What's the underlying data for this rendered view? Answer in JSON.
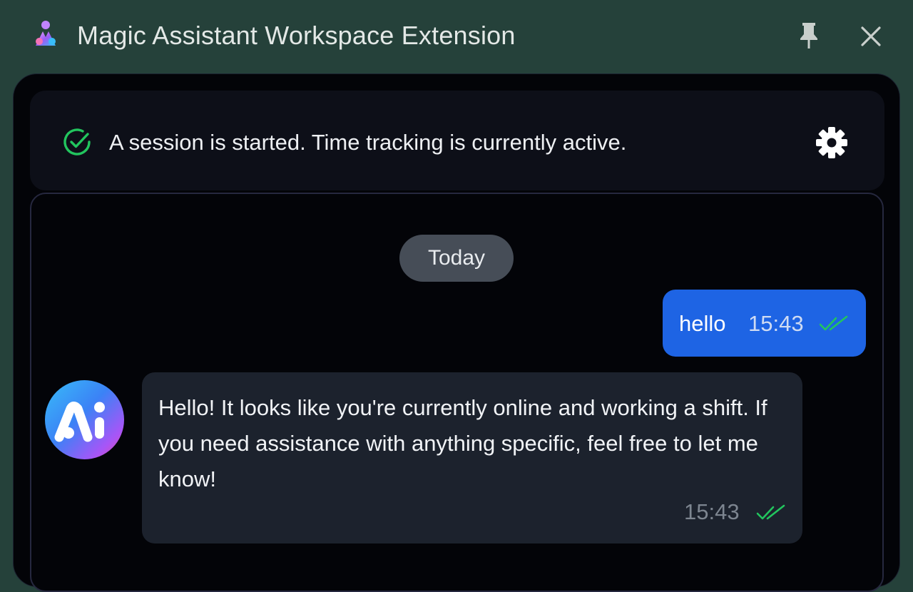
{
  "window": {
    "title": "Magic Assistant Workspace Extension",
    "logo_icon": "magic-assistant-logo-icon",
    "pin_icon": "pin-icon",
    "close_icon": "close-icon"
  },
  "session": {
    "status_text": "A session is started. Time tracking is currently active.",
    "status_icon": "check-circle-icon",
    "status_color": "#22c55e",
    "settings_icon": "gear-icon"
  },
  "chat": {
    "date_divider": "Today",
    "messages": [
      {
        "sender": "user",
        "text": "hello",
        "time": "15:43",
        "status_icon": "double-check-icon",
        "bubble_color": "#1e64e4"
      },
      {
        "sender": "assistant",
        "avatar_text": "Ai",
        "text": "Hello! It looks like you're currently online and working a shift. If you need assistance with anything specific, feel free to let me know!",
        "time": "15:43",
        "status_icon": "double-check-icon",
        "bubble_color": "#1c222d"
      }
    ]
  },
  "colors": {
    "window_bg": "#25413a",
    "panel_bg": "#030408",
    "accent_blue": "#1e64e4",
    "read_check": "#22c55e"
  }
}
